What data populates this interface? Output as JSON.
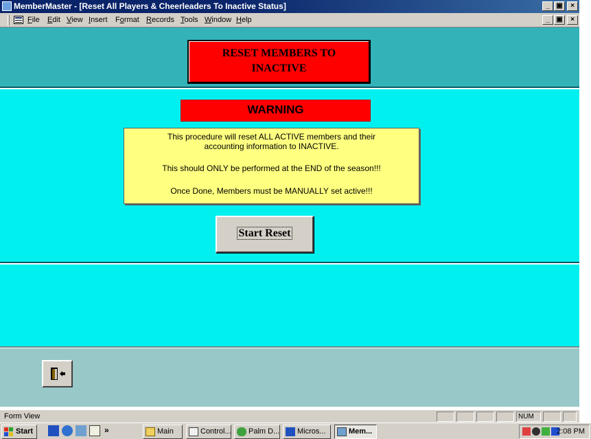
{
  "window": {
    "title": "MemberMaster - [Reset All Players & Cheerleaders To Inactive Status]",
    "min_glyph": "_",
    "max_glyph": "▣",
    "close_glyph": "×"
  },
  "menu": {
    "items": [
      {
        "hot": "F",
        "rest": "ile"
      },
      {
        "hot": "E",
        "rest": "dit"
      },
      {
        "hot": "V",
        "rest": "iew"
      },
      {
        "hot": "I",
        "rest": "nsert"
      },
      {
        "hot": "",
        "pre": "F",
        "hot2": "o",
        "rest": "rmat"
      },
      {
        "hot": "R",
        "rest": "ecords"
      },
      {
        "hot": "T",
        "rest": "ools"
      },
      {
        "hot": "W",
        "rest": "indow"
      },
      {
        "hot": "H",
        "rest": "elp"
      }
    ]
  },
  "form": {
    "title_line1": "RESET MEMBERS TO",
    "title_line2": "INACTIVE",
    "warning_label": "WARNING",
    "warning_lines": [
      "This procedure will reset  ALL  ACTIVE  members and their",
      "accounting information to INACTIVE.",
      "This should ONLY be performed at the END of the season!!!",
      "Once Done, Members must be MANUALLY set active!!!"
    ],
    "start_button_label": "Start Reset"
  },
  "statusbar": {
    "text": "Form View",
    "num": "NUM"
  },
  "taskbar": {
    "start_label": "Start",
    "chevron": "»",
    "buttons": [
      "Main",
      "Control...",
      "Palm D...",
      "Micros...",
      "Mem..."
    ],
    "clock": "2:08 PM"
  },
  "colors": {
    "header_bg": "#33b3b8",
    "detail_bg": "#00f0f0",
    "footer_bg": "#98c8c8",
    "warning_red": "#ff0000",
    "warning_box": "#ffff80"
  },
  "icons": {
    "exit": "exit-door-icon"
  }
}
